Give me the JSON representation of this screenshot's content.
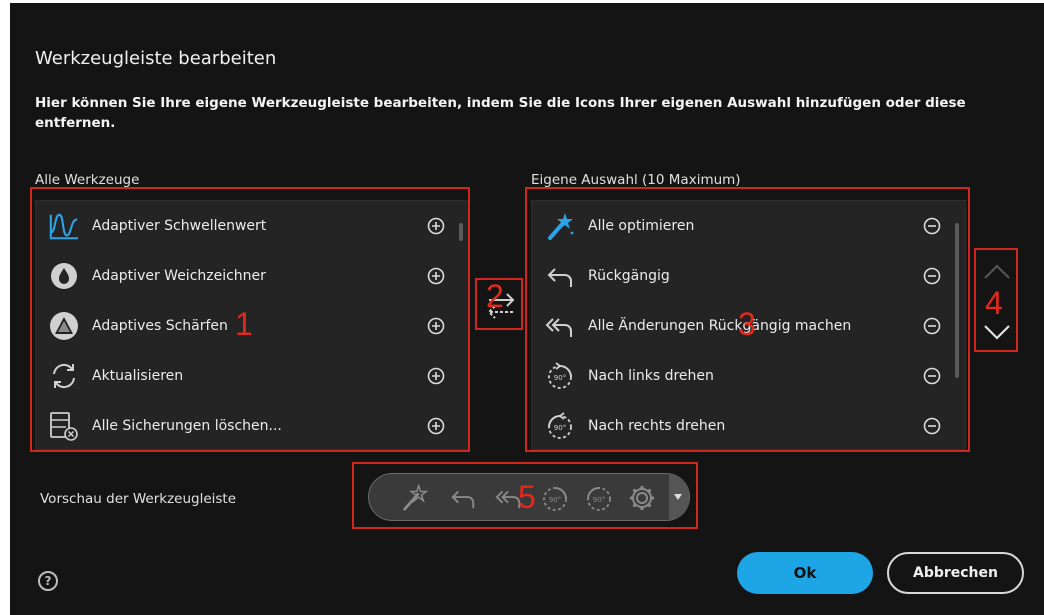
{
  "dialog": {
    "title": "Werkzeugleiste bearbeiten",
    "description": "Hier können Sie Ihre eigene Werkzeugleiste bearbeiten, indem Sie die Icons Ihrer eigenen Auswahl hinzufügen oder diese entfernen."
  },
  "all_tools": {
    "label": "Alle Werkzeuge",
    "items": [
      {
        "label": "Adaptiver Schwellenwert",
        "icon": "threshold-wave-icon"
      },
      {
        "label": "Adaptiver Weichzeichner",
        "icon": "blur-drop-icon"
      },
      {
        "label": "Adaptives Schärfen",
        "icon": "sharpen-triangle-icon"
      },
      {
        "label": "Aktualisieren",
        "icon": "refresh-icon"
      },
      {
        "label": "Alle Sicherungen löschen...",
        "icon": "delete-backups-icon"
      }
    ]
  },
  "own_selection": {
    "label": "Eigene Auswahl (10 Maximum)",
    "items": [
      {
        "label": "Alle optimieren",
        "icon": "magic-wand-icon"
      },
      {
        "label": "Rückgängig",
        "icon": "undo-icon"
      },
      {
        "label": "Alle Änderungen Rückgängig machen",
        "icon": "undo-all-icon"
      },
      {
        "label": "Nach links drehen",
        "icon": "rotate-left-icon"
      },
      {
        "label": "Nach rechts drehen",
        "icon": "rotate-right-icon"
      }
    ]
  },
  "preview": {
    "label": "Vorschau der Werkzeugleiste",
    "icons": [
      "magic-wand-icon",
      "undo-icon",
      "undo-all-icon",
      "rotate-left-icon",
      "rotate-right-icon",
      "gear-icon"
    ]
  },
  "buttons": {
    "ok": "Ok",
    "cancel": "Abbrechen"
  },
  "help": "?",
  "annotations": [
    "1",
    "2",
    "3",
    "4",
    "5"
  ],
  "colors": {
    "background": "#141414",
    "accent": "#1ea5e6",
    "annotation": "#d0261e"
  }
}
